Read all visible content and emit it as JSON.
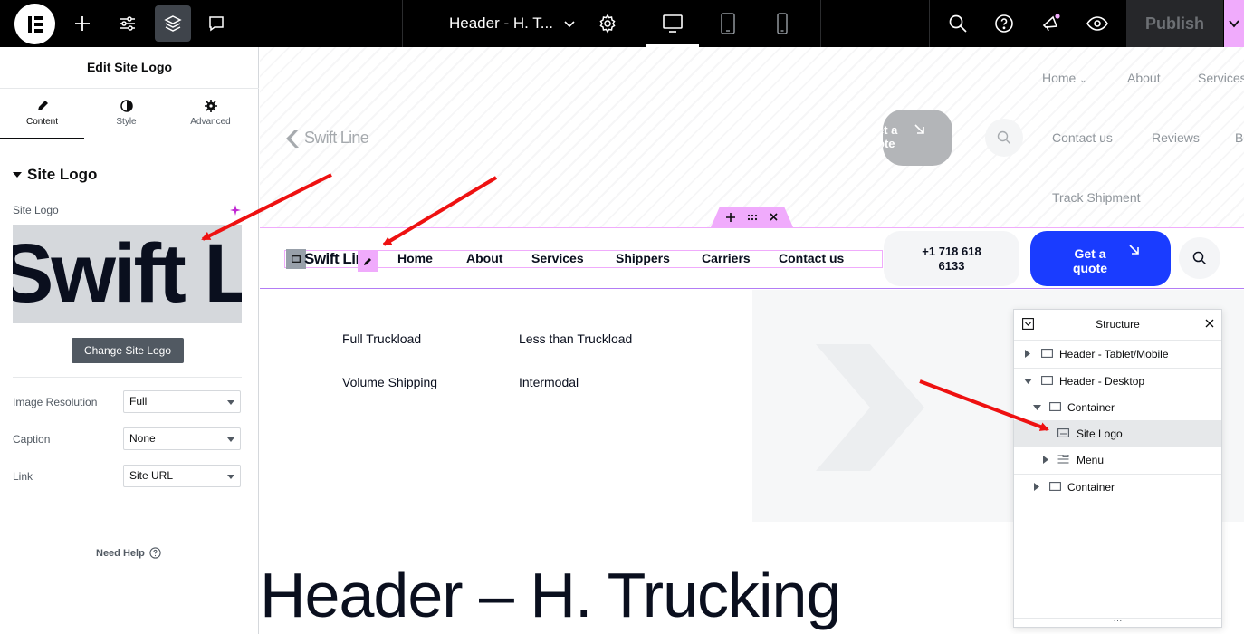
{
  "topbar": {
    "doc_title": "Header - H. T...",
    "publish_label": "Publish"
  },
  "panel": {
    "title": "Edit Site Logo",
    "tabs": [
      {
        "label": "Content"
      },
      {
        "label": "Style"
      },
      {
        "label": "Advanced"
      }
    ],
    "section_title": "Site Logo",
    "site_logo_label": "Site Logo",
    "logo_preview_text": "Swift Li",
    "change_logo_label": "Change Site Logo",
    "fields": [
      {
        "label": "Image Resolution",
        "value": "Full"
      },
      {
        "label": "Caption",
        "value": "None"
      },
      {
        "label": "Link",
        "value": "Site URL"
      }
    ],
    "need_help": "Need Help"
  },
  "canvas": {
    "ghost_nav_row1": [
      "Home",
      "About",
      "Services"
    ],
    "ghost_logo": "Swift Line",
    "ghost_quote": "et a ote",
    "ghost_nav_row2": [
      "Contact us",
      "Reviews",
      "Bl"
    ],
    "ghost_nav_row3": [
      "Track Shipment"
    ],
    "header_logo": "Swift Line",
    "menu": [
      "Home",
      "About",
      "Services",
      "Shippers",
      "Carriers",
      "Contact us"
    ],
    "phone": "+1 718 618 6133",
    "quote_label": "Get a quote",
    "mega_items": [
      "Full Truckload",
      "Less than Truckload",
      "Volume Shipping",
      "Intermodal"
    ],
    "page_title": "Header – H. Trucking"
  },
  "structure": {
    "title": "Structure",
    "rows": [
      {
        "label": "Header - Tablet/Mobile"
      },
      {
        "label": "Header - Desktop"
      },
      {
        "label": "Container"
      },
      {
        "label": "Site Logo"
      },
      {
        "label": "Menu"
      },
      {
        "label": "Container"
      }
    ]
  },
  "colors": {
    "accent_pink": "#f0abfc",
    "quote_blue": "#1a3cff",
    "annotation_red": "#ee1111"
  }
}
